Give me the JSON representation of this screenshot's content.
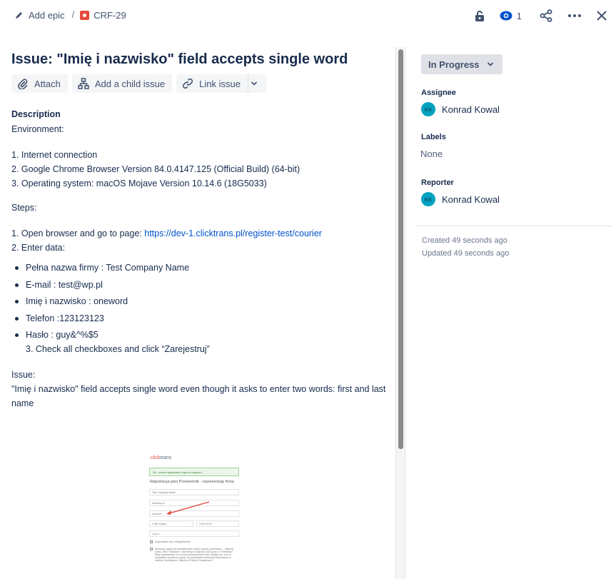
{
  "breadcrumb": {
    "epic_label": "Add epic",
    "separator": "/",
    "issue_key": "CRF-29"
  },
  "toolbar": {
    "watch_count": "1"
  },
  "issue": {
    "title": "Issue: \"Imię i nazwisko\" field accepts single word",
    "buttons": {
      "attach": "Attach",
      "add_child": "Add a child issue",
      "link": "Link issue"
    }
  },
  "description": {
    "heading": "Description",
    "environment_label": "Environment:",
    "environment": [
      "1. Internet connection",
      "2. Google Chrome Browser Version 84.0.4147.125 (Official Build) (64-bit)",
      "3. Operating system: macOS Mojave Version 10.14.6 (18G5033)"
    ],
    "steps_label": "Steps:",
    "step1_prefix": "1. Open browser and go to page: ",
    "step1_link": "https://dev-1.clicktrans.pl/register-test/courier",
    "step2": "2. Enter data:",
    "data": [
      "Pełna nazwa firmy : Test Company Name",
      "E-mail : test@wp.pl",
      "Imię i nazwisko : oneword",
      "Telefon :123123123",
      "Hasło : guy&^%$5"
    ],
    "step3": "3. Check all checkboxes and click “Zarejestruj”",
    "issue_label": "Issue:",
    "issue_text": "\"Imię i nazwisko\" field accepts single word even though it asks to enter two words: first and last name"
  },
  "attachment": {
    "logo_a": "click",
    "logo_b": "trans",
    "alert": "Ok - some registration login is required",
    "form_title": "Rejestracja jako Przewoźnik - reprezentuję firmę",
    "fields": [
      "Test Company Name",
      "test@wp.pl",
      "oneword",
      "(+48) Polska",
      "123123123",
      "••••••••"
    ],
    "check1": "Zapoznałem się z Regulaminem",
    "check2": "Wyrażam zgodę na przetwarzanie moich danych osobowych... (więcej) przez „SMC Solutions” z siedzibą w Gdyni (81-532) przy ul. Powstania Wlkp przesłanego 20 w celu przetwarzania konta i dostęp lub, m.in w przypadku wyrażenia zgody, na przesyłanie informacji handlowych w zakresie przedsięwz. Więcej w Polityce Prywatności"
  },
  "sidebar": {
    "status": "In Progress",
    "assignee_label": "Assignee",
    "assignee_initials": "KK",
    "assignee_name": "Konrad Kowal",
    "labels_label": "Labels",
    "labels_value": "None",
    "reporter_label": "Reporter",
    "reporter_initials": "KK",
    "reporter_name": "Konrad Kowal",
    "created": "Created 49 seconds ago",
    "updated": "Updated 49 seconds ago"
  },
  "colors": {
    "link": "#0052cc",
    "bug_icon": "#e5493a",
    "avatar": "#00a3bf",
    "watch_icon": "#0052cc"
  }
}
